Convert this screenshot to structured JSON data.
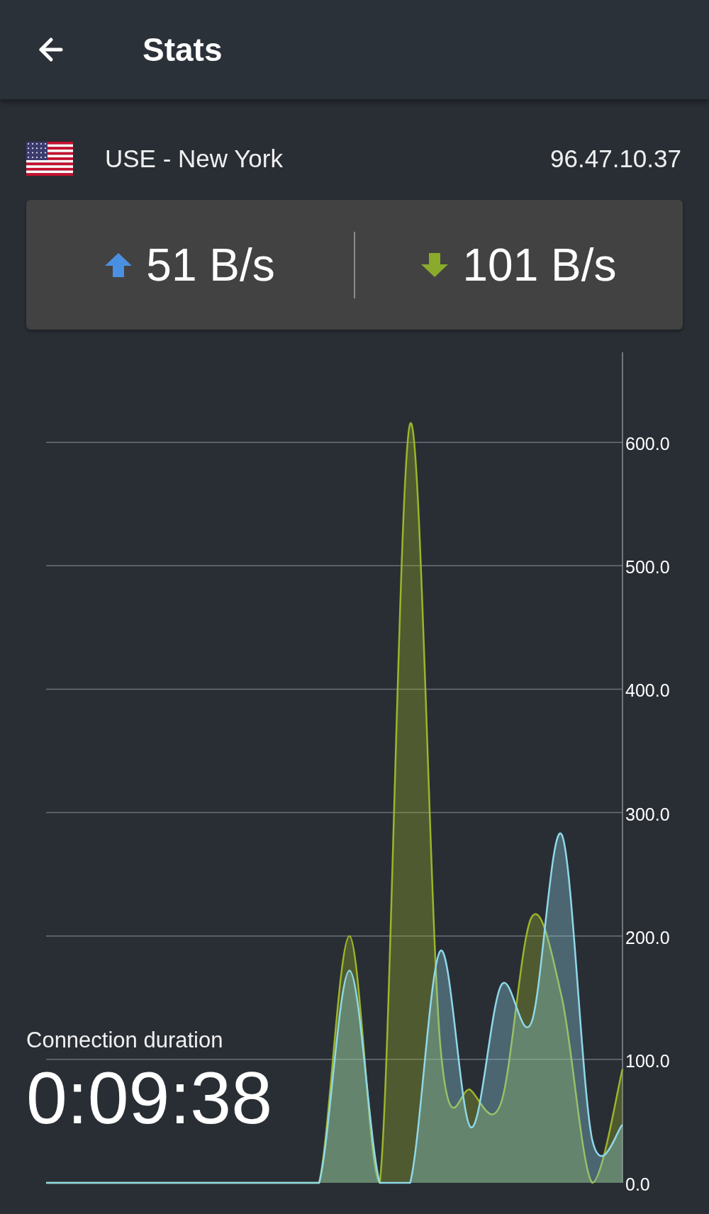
{
  "header": {
    "title": "Stats"
  },
  "location": {
    "name": "USE - New York",
    "ip": "96.47.10.37"
  },
  "speeds": [
    {
      "kind": "upload",
      "value": "51 B/s"
    },
    {
      "kind": "download",
      "value": "101 B/s"
    }
  ],
  "chart": {
    "chart_data": {
      "type": "area",
      "grid": true,
      "ylim": [
        0,
        673
      ],
      "yticks": [
        {
          "value": 0,
          "label": "0.0"
        },
        {
          "value": 100,
          "label": "100.0"
        },
        {
          "value": 200,
          "label": "200.0"
        },
        {
          "value": 300,
          "label": "300.0"
        },
        {
          "value": 400,
          "label": "400.0"
        },
        {
          "value": 500,
          "label": "500.0"
        },
        {
          "value": 600,
          "label": "600.0"
        }
      ],
      "series": [
        {
          "color": "#9cb52a",
          "values": [
            0,
            0,
            0,
            0,
            0,
            0,
            0,
            0,
            0,
            0,
            200,
            0,
            615,
            110,
            75,
            65,
            215,
            150,
            0,
            92
          ]
        },
        {
          "color": "#8fd8e8",
          "values": [
            0,
            0,
            0,
            0,
            0,
            0,
            0,
            0,
            0,
            0,
            172,
            0,
            0,
            188,
            45,
            160,
            130,
            282,
            35,
            47
          ]
        }
      ]
    }
  },
  "duration": {
    "label": "Connection duration",
    "value": "0:09:38"
  }
}
